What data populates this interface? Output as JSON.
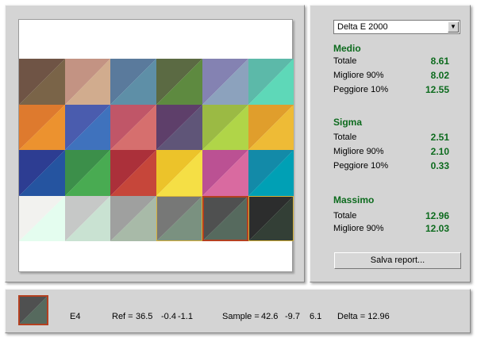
{
  "metric_select": {
    "selected": "Delta E 2000"
  },
  "sections": [
    {
      "title": "Medio",
      "rows": [
        {
          "label": "Totale",
          "value": "8.61"
        },
        {
          "label": "Migliore 90%",
          "value": "8.02"
        },
        {
          "label": "Peggiore 10%",
          "value": "12.55"
        }
      ]
    },
    {
      "title": "Sigma",
      "rows": [
        {
          "label": "Totale",
          "value": "2.51"
        },
        {
          "label": "Migliore 90%",
          "value": "2.10"
        },
        {
          "label": "Peggiore 10%",
          "value": "0.33"
        }
      ]
    },
    {
      "title": "Massimo",
      "rows": [
        {
          "label": "Totale",
          "value": "12.96"
        },
        {
          "label": "Migliore 90%",
          "value": "12.03"
        }
      ]
    }
  ],
  "report_button": "Salva report...",
  "patches": [
    [
      "#6f5445",
      "#7a6448"
    ],
    [
      "#c39383",
      "#d1ac8e"
    ],
    [
      "#5a7a9c",
      "#5e8fa7"
    ],
    [
      "#5b6a43",
      "#5e8a40"
    ],
    [
      "#8482b2",
      "#8ca2bd"
    ],
    [
      "#5cb9a9",
      "#5ed8b8"
    ],
    [
      "#de7a2e",
      "#ec922f"
    ],
    [
      "#4a5cae",
      "#3f72bd"
    ],
    [
      "#c05668",
      "#d66f6e"
    ],
    [
      "#5e3f6a",
      "#5f5578"
    ],
    [
      "#9bba44",
      "#b0d548"
    ],
    [
      "#e09e2c",
      "#eebb36"
    ],
    [
      "#2d3d92",
      "#2554a0"
    ],
    [
      "#3c8f4a",
      "#49ab52"
    ],
    [
      "#ab303a",
      "#c6463a"
    ],
    [
      "#ecc32a",
      "#f5df45"
    ],
    [
      "#bb5193",
      "#d96aa0"
    ],
    [
      "#138aa8",
      "#00a0b5"
    ],
    [
      "#f2f2ef",
      "#e4fdef"
    ],
    [
      "#c6c8c7",
      "#c9e2d2"
    ],
    [
      "#9fa09f",
      "#a8baa8"
    ],
    [
      "#777877",
      "#7a9180"
    ],
    [
      "#4f5050",
      "#566a5e"
    ],
    [
      "#2c2d2d",
      "#333f36"
    ]
  ],
  "selected_patch": {
    "id": "E4",
    "ref_label": "Ref =",
    "ref": [
      "36.5",
      "-0.4",
      "-1.1"
    ],
    "sample_label": "Sample =",
    "sample": [
      "42.6",
      "-9.7",
      "6.1"
    ],
    "delta_text": "Delta = 12.96",
    "colors": [
      "#4f5050",
      "#566a5e"
    ]
  }
}
